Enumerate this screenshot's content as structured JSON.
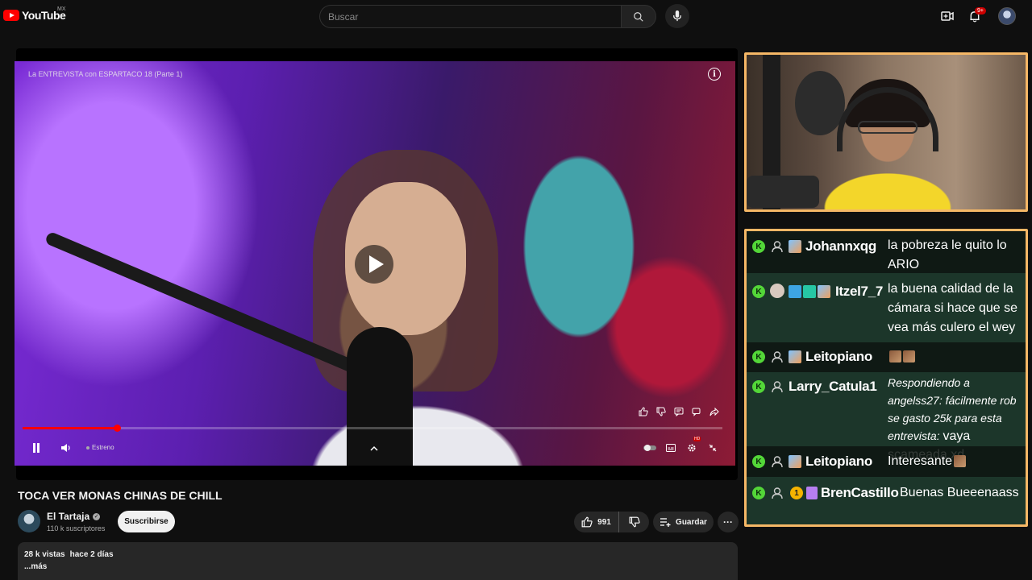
{
  "header": {
    "logo_text": "YouTube",
    "region": "MX",
    "search_placeholder": "Buscar",
    "notif_count": "9+"
  },
  "player": {
    "overlay_title": "La ENTREVISTA con ESPARTACO 18 (Parte 1)",
    "live_label": "Estreno",
    "progress_fraction": 0.135
  },
  "video": {
    "title": "TOCA VER MONAS CHINAS DE CHILL",
    "channel": "El Tartaja",
    "subscribers": "110 k suscriptores",
    "subscribe_label": "Suscribirse",
    "likes": "991",
    "save_label": "Guardar",
    "views": "28 k vistas",
    "age": "hace 2 días",
    "more_label": "...más"
  },
  "chat": {
    "messages": [
      {
        "user": "Johannxqg",
        "text": "la pobreza le quito lo ARIO"
      },
      {
        "user": "Itzel7_7",
        "text": "la buena calidad de la cámara si hace que se vea más culero el wey"
      },
      {
        "user": "Leitopiano",
        "text": ""
      },
      {
        "user": "Larry_Catula1",
        "reply": "Respondiendo a angelss27: fácilmente rob se gasto 25k para esta entrevista:",
        "text": "vaya scameada xd"
      },
      {
        "user": "Leitopiano",
        "text": "Interesante"
      },
      {
        "user": "BrenCastillo",
        "text": "Buenas Bueeenaass",
        "level": "1"
      }
    ]
  },
  "colors": {
    "accent": "#ff0000",
    "overlay_border": "#f5b766",
    "chat_badge": "#53d638"
  }
}
